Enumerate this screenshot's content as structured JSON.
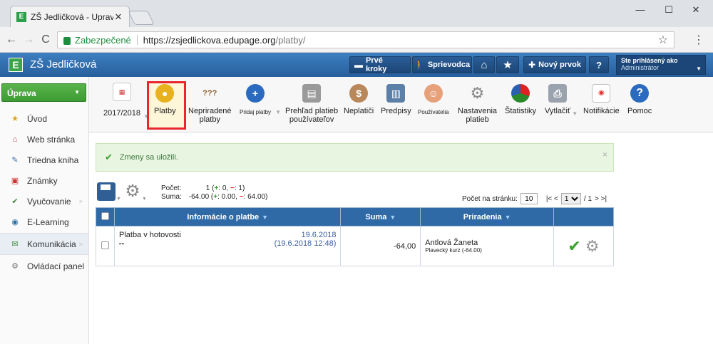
{
  "browser": {
    "tab_title": "ZŠ Jedličková - Upraviť vz",
    "tab_close": "✕",
    "win_min": "—",
    "win_max": "☐",
    "win_close": "✕",
    "back": "←",
    "forward": "→",
    "reload": "C",
    "secure_label": "Zabezpečené",
    "url_host": "https://zsjedlickova.edupage.org",
    "url_path": "/platby/",
    "star": "☆",
    "menu": "⋮"
  },
  "appbar": {
    "school_name": "ZŠ Jedličková",
    "logo_letter": "E",
    "buttons": [
      {
        "label": "Prvé kroky",
        "icon": "▬"
      },
      {
        "label": "Sprievodca",
        "icon": "🚶"
      },
      {
        "label": "",
        "icon": "⌂"
      },
      {
        "label": "",
        "icon": "★"
      },
      {
        "label": "Nový prvok",
        "icon": "✚"
      },
      {
        "label": "?",
        "icon": ""
      }
    ],
    "user_line1": "Ste prihlásený ako",
    "user_line2": "Administrátor"
  },
  "sidebar": {
    "primary_button": "Úprava",
    "items": [
      {
        "label": "Úvod",
        "icon": "★"
      },
      {
        "label": "Web stránka",
        "icon": "⌂"
      },
      {
        "label": "Triedna kniha",
        "icon": "✎"
      },
      {
        "label": "Známky",
        "icon": "▣"
      },
      {
        "label": "Vyučovanie",
        "icon": "✔"
      },
      {
        "label": "E-Learning",
        "icon": "◉"
      },
      {
        "label": "Komunikácia",
        "icon": "✉"
      },
      {
        "label": "Ovládací panel",
        "icon": "⚙"
      }
    ]
  },
  "toolbar": {
    "year": "2017/2018",
    "platby": "Platby",
    "nepriradene_1": "Nepriradené",
    "nepriradene_2": "platby",
    "pridaj": "Pridaj platby",
    "prehlad_1": "Prehľad platieb",
    "prehlad_2": "používateľov",
    "neplatici": "Neplatiči",
    "predpisy": "Predpisy",
    "pouzivatelia": "Používatelia",
    "nastavenia_1": "Nastavenia",
    "nastavenia_2": "platieb",
    "statistiky": "Štatistiky",
    "vytlacit": "Vytlačiť",
    "notifikacie": "Notifikácie",
    "pomoc": "Pomoc",
    "unknown_badge": "???"
  },
  "alert": {
    "message": "Zmeny sa uložili.",
    "close": "×"
  },
  "summary": {
    "count_label": "Počet:",
    "count_value": "1 (",
    "count_plus": "+",
    "count_mid": ": 0,",
    "count_minus": "−",
    "count_end": ": 1)",
    "sum_label": "Suma:",
    "sum_value": "-64.00 (",
    "sum_plus": "+",
    "sum_mid": ": 0.00,",
    "sum_minus": "−",
    "sum_end": ": 64.00)"
  },
  "pager": {
    "per_page_label": "Počet na stránku:",
    "per_page_value": "10",
    "first_prev": "|< <",
    "page": "1",
    "of": "/ 1",
    "next_last": "> >|"
  },
  "table": {
    "headers": [
      "Informácie o platbe",
      "Suma",
      "Priradenia"
    ],
    "rows": [
      {
        "title": "Platba v hotovosti",
        "note": "\"\"",
        "date": "19.6.2018",
        "datetime": "(19.6.2018 12:48)",
        "amount": "-64,00",
        "assignee": "Antlová Žaneta",
        "assignee_detail": "Plavecký kurz (-64.00)"
      }
    ]
  }
}
